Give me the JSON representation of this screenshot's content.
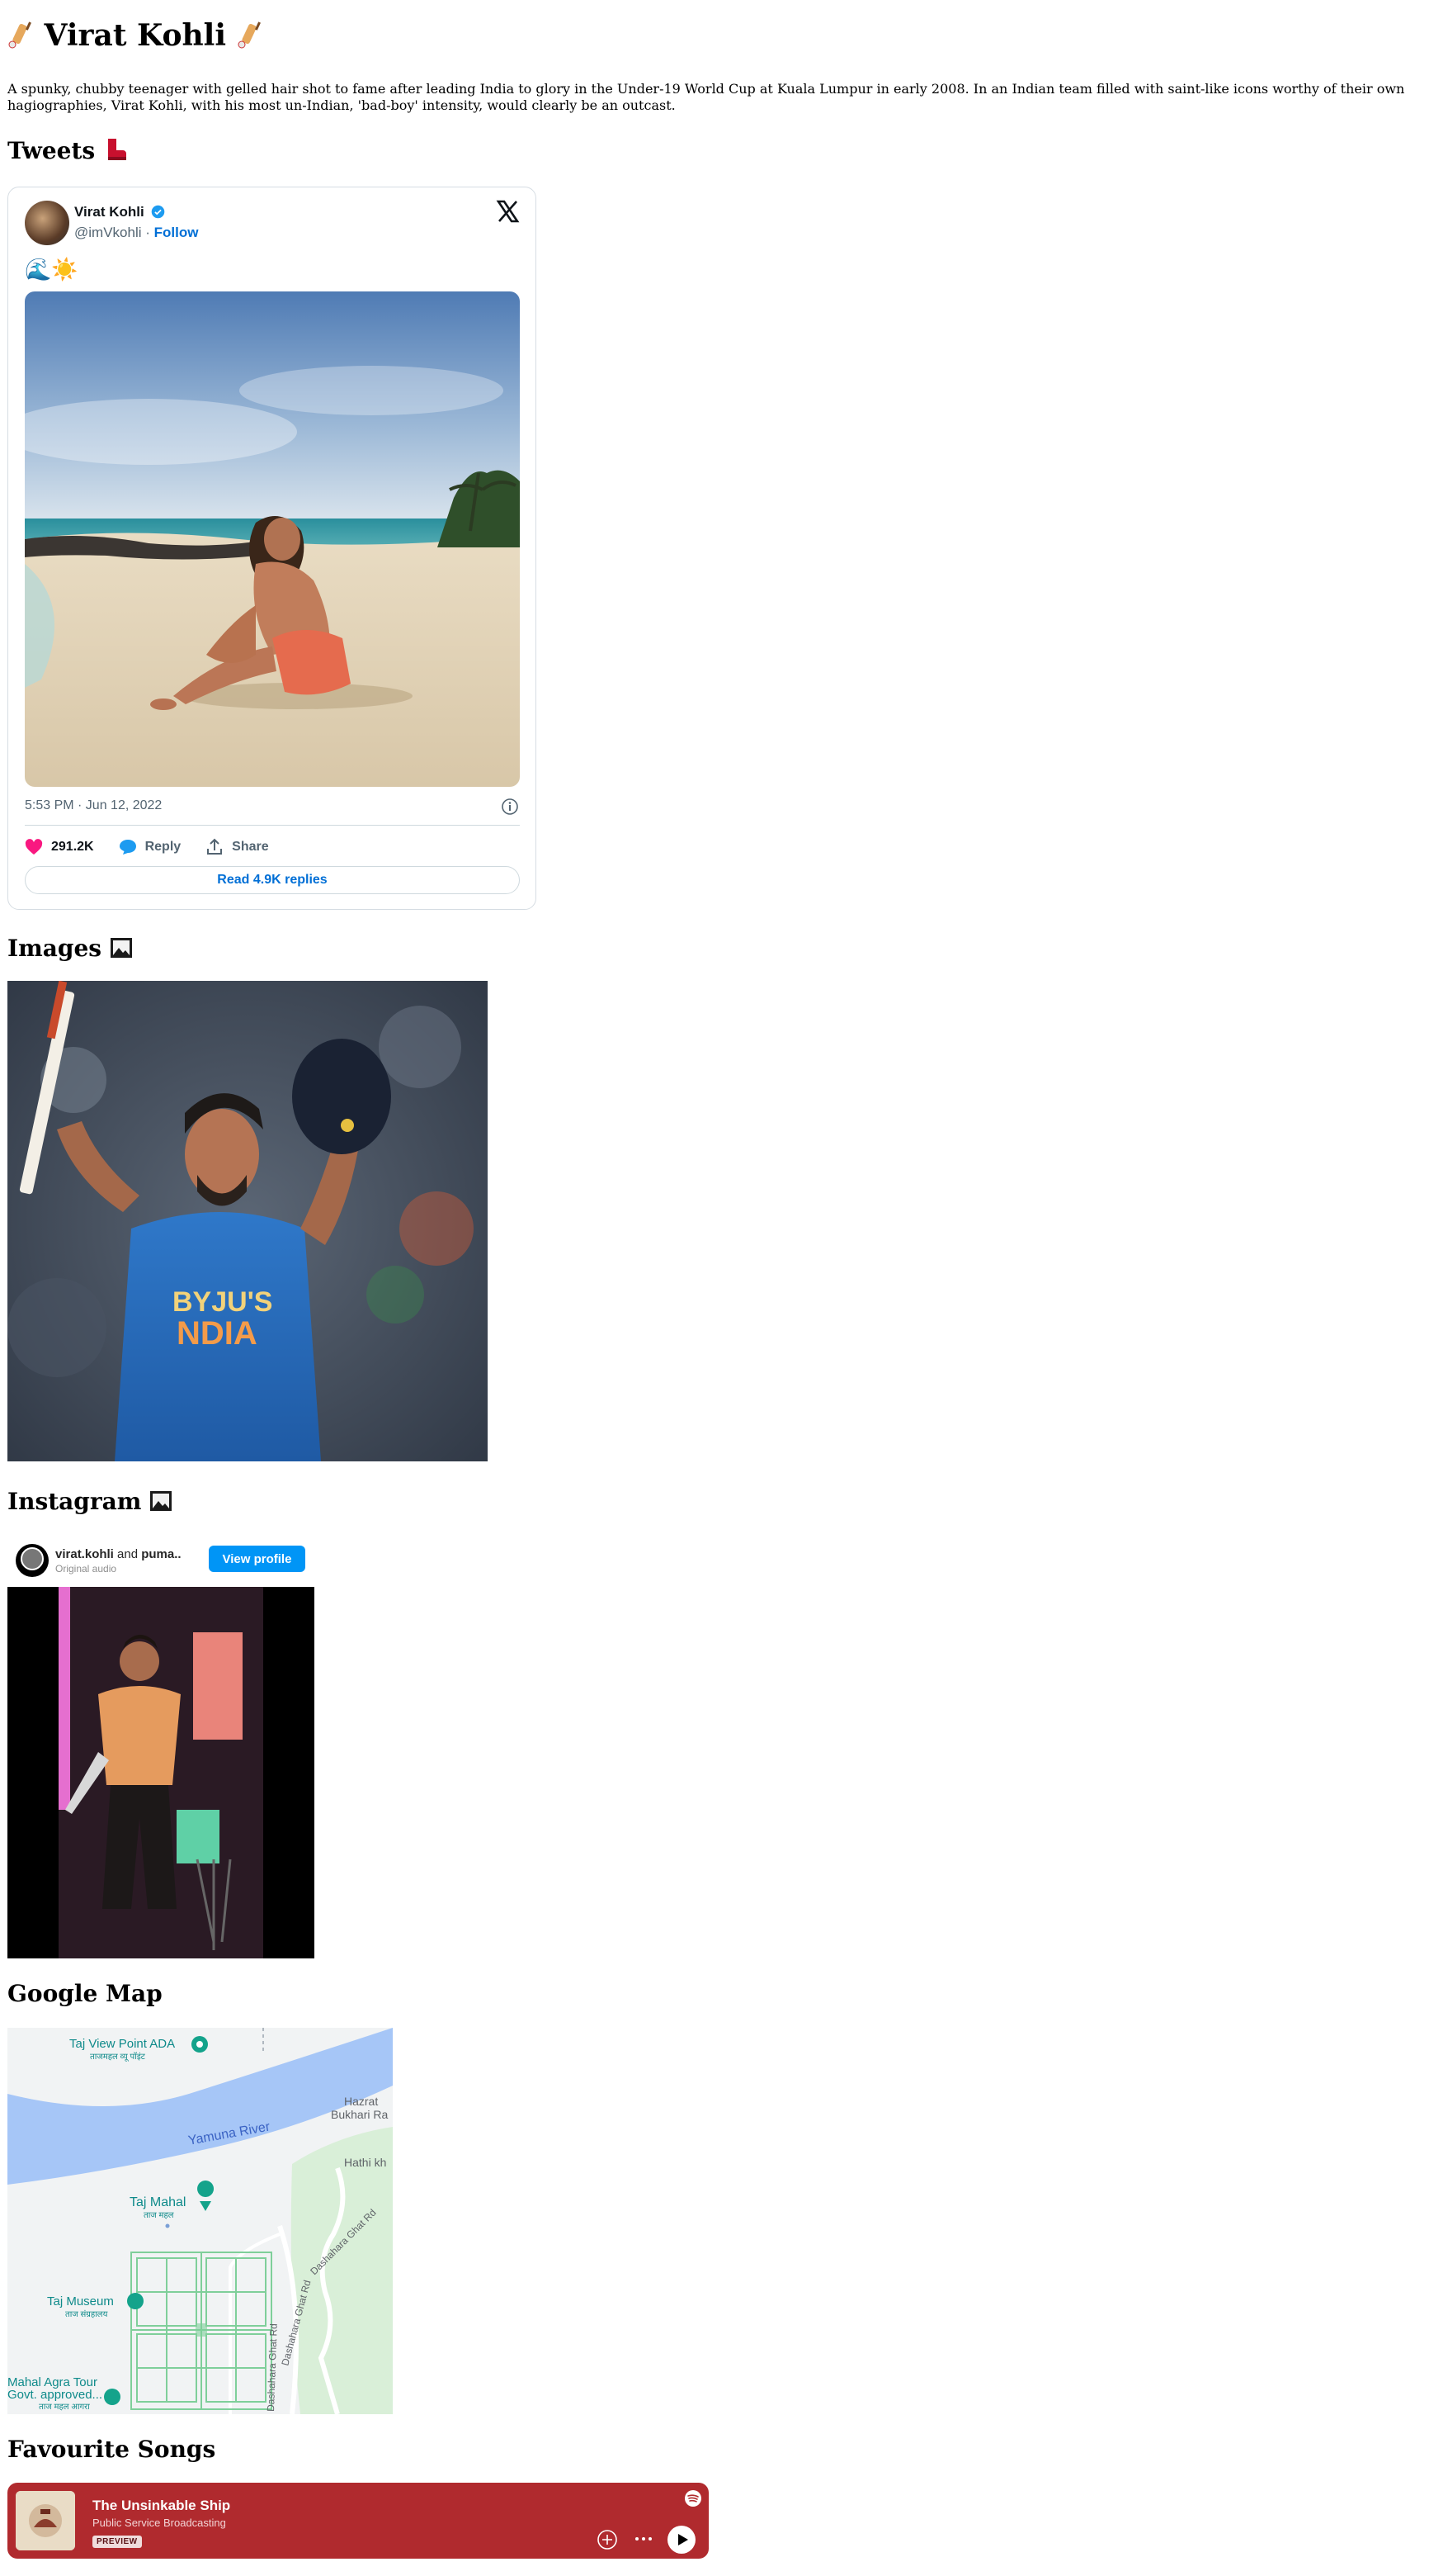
{
  "page": {
    "title": "Virat Kohli",
    "intro": "A spunky, chubby teenager with gelled hair shot to fame after leading India to glory in the Under-19 World Cup at Kuala Lumpur in early 2008. In an Indian team filled with saint-like icons worthy of their own hagiographies, Virat Kohli, with his most un-Indian, 'bad-boy' intensity, would clearly be an outcast."
  },
  "sections": {
    "tweets": "Tweets",
    "images": "Images",
    "instagram": "Instagram",
    "map": "Google Map",
    "songs": "Favourite Songs"
  },
  "tweet": {
    "name": "Virat Kohli",
    "handle": "@imVkohli",
    "separator": " · ",
    "follow": "Follow",
    "emoji": "🌊☀️",
    "timestamp": "5:53 PM · Jun 12, 2022",
    "likes": "291.2K",
    "reply": "Reply",
    "share": "Share",
    "read_replies": "Read 4.9K replies"
  },
  "instagram": {
    "account": "virat.kohli",
    "and": " and ",
    "collab": "puma..",
    "audio": "Original audio",
    "view_profile": "View profile"
  },
  "map": {
    "labels": {
      "taj_view_point": "Taj View Point ADA",
      "taj_view_point_hi": "ताजमहल व्यू पॉइंट",
      "yamuna": "Yamuna River",
      "hazrat": "Hazrat",
      "bukhari": "Bukhari Ra",
      "hathi": "Hathi kh",
      "taj_mahal": "Taj Mahal",
      "taj_mahal_hi": "ताज महल",
      "taj_museum": "Taj Museum",
      "taj_museum_hi": "ताज संग्रहालय",
      "dashahara": "Dashahara Ghat Rd",
      "agra_tour_1": "Mahal Agra Tour",
      "agra_tour_2": "Govt. approved...",
      "agra_tour_hi": "ताज महल आगरा"
    }
  },
  "song": {
    "title": "The Unsinkable Ship",
    "artist": "Public Service Broadcasting",
    "badge": "PREVIEW"
  },
  "colors": {
    "spotify_bg": "#b02a2e",
    "twitter_blue": "#1d9bf0",
    "like_pink": "#f91880",
    "instagram_blue": "#0095f6",
    "map_water": "#a6c6f7",
    "map_park": "#d9efd8"
  }
}
